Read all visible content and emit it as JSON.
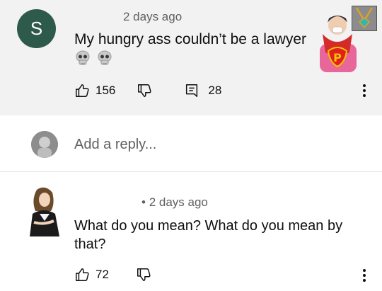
{
  "comment": {
    "avatar_letter": "S",
    "timestamp": "2 days ago",
    "text": "My hungry ass couldn’t be a lawyer",
    "emojis": [
      "skull",
      "skull"
    ],
    "like_count": "156",
    "reply_count": "28",
    "sticker_letter": "P",
    "colors": {
      "avatar_bg": "#2d5a4b",
      "card_bg": "#f2f2f2"
    }
  },
  "reply_box": {
    "placeholder": "Add a reply..."
  },
  "reply": {
    "timestamp": "2 days ago",
    "text": "What do you mean? What do you mean by that?",
    "like_count": "72"
  },
  "icons": [
    "thumbs-up-icon",
    "thumbs-down-icon",
    "comment-icon",
    "more-vert-icon",
    "skull-icon"
  ]
}
